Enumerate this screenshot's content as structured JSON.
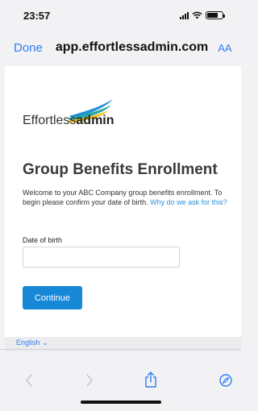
{
  "status_bar": {
    "time": "23:57"
  },
  "browser": {
    "done_label": "Done",
    "url": "app.effortlessadmin.com",
    "text_size_label": "AA"
  },
  "logo": {
    "text_light": "Effortless",
    "text_bold": "admin"
  },
  "page": {
    "heading": "Group Benefits Enrollment",
    "welcome_text": "Welcome to your ABC Company group benefits enrollment. To begin please confirm your date of birth.",
    "why_link": "Why do we ask for this?",
    "dob_label": "Date of birth",
    "dob_value": "",
    "continue_label": "Continue"
  },
  "footer": {
    "language": "English ⌄"
  },
  "colors": {
    "accent": "#2e7cf6",
    "button": "#1787d8"
  }
}
